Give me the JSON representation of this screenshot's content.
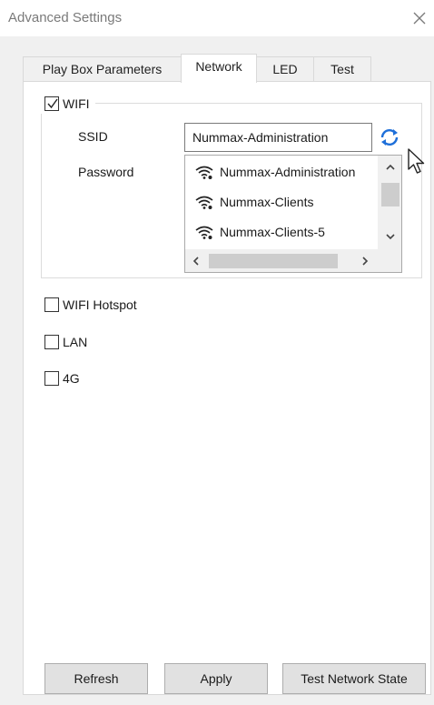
{
  "window": {
    "title": "Advanced Settings",
    "close_icon": "close-icon"
  },
  "tabs": [
    {
      "label": "Play Box Parameters",
      "active": false
    },
    {
      "label": "Network",
      "active": true
    },
    {
      "label": "LED",
      "active": false
    },
    {
      "label": "Test",
      "active": false
    }
  ],
  "network": {
    "wifi": {
      "label": "WIFI",
      "checked": true,
      "ssid_label": "SSID",
      "ssid_value": "Nummax-Administration",
      "password_label": "Password",
      "refresh_icon": "refresh-icon",
      "networks": [
        {
          "name": "Nummax-Administration",
          "icon": "wifi-icon"
        },
        {
          "name": "Nummax-Clients",
          "icon": "wifi-icon"
        },
        {
          "name": "Nummax-Clients-5",
          "icon": "wifi-icon"
        }
      ]
    },
    "wifi_hotspot": {
      "label": "WIFI Hotspot",
      "checked": false
    },
    "lan": {
      "label": "LAN",
      "checked": false
    },
    "four_g": {
      "label": "4G",
      "checked": false
    }
  },
  "buttons": {
    "refresh": "Refresh",
    "apply": "Apply",
    "test_network_state": "Test Network State"
  },
  "colors": {
    "refresh_icon": "#1e6fd9",
    "window_bg": "#f0f0f0",
    "button_bg": "#e1e1e1"
  }
}
